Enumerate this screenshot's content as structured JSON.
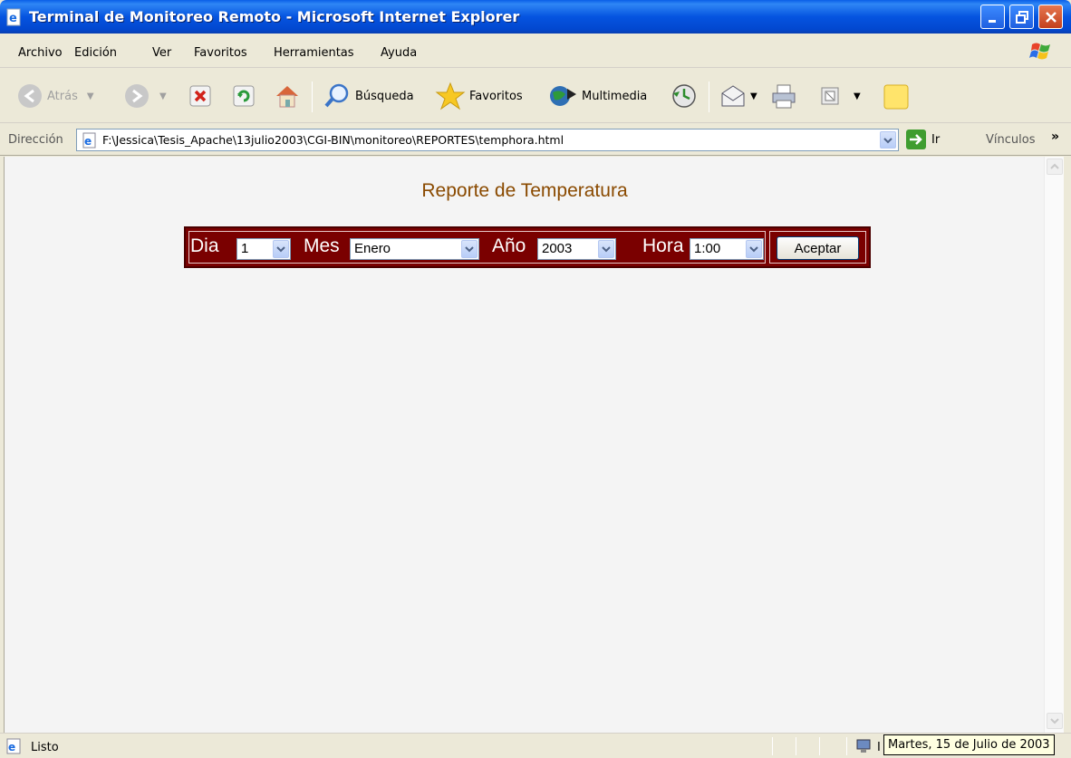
{
  "window": {
    "title": "Terminal de Monitoreo Remoto - Microsoft Internet Explorer"
  },
  "menu": [
    "Archivo",
    "Edición",
    "Ver",
    "Favoritos",
    "Herramientas",
    "Ayuda"
  ],
  "toolbar": {
    "back": "Atrás",
    "search": "Búsqueda",
    "favorites": "Favoritos",
    "media": "Multimedia"
  },
  "address": {
    "label": "Dirección",
    "url": "F:\\Jessica\\Tesis_Apache\\13julio2003\\CGI-BIN\\monitoreo\\REPORTES\\temphora.html",
    "go": "Ir",
    "links": "Vínculos"
  },
  "report": {
    "title": "Reporte de Temperatura",
    "day_label": "Dia",
    "day_value": "1",
    "month_label": "Mes",
    "month_value": "Enero",
    "year_label": "Año",
    "year_value": "2003",
    "hour_label": "Hora",
    "hour_value": "1:00",
    "submit": "Aceptar"
  },
  "status": {
    "text": "Listo",
    "zone_fragment": "I",
    "tooltip": "Martes, 15 de Julio de 2003"
  },
  "colors": {
    "title_bar": "#0554e0",
    "form_bg": "#7a0000",
    "report_title": "#8a4a00"
  }
}
